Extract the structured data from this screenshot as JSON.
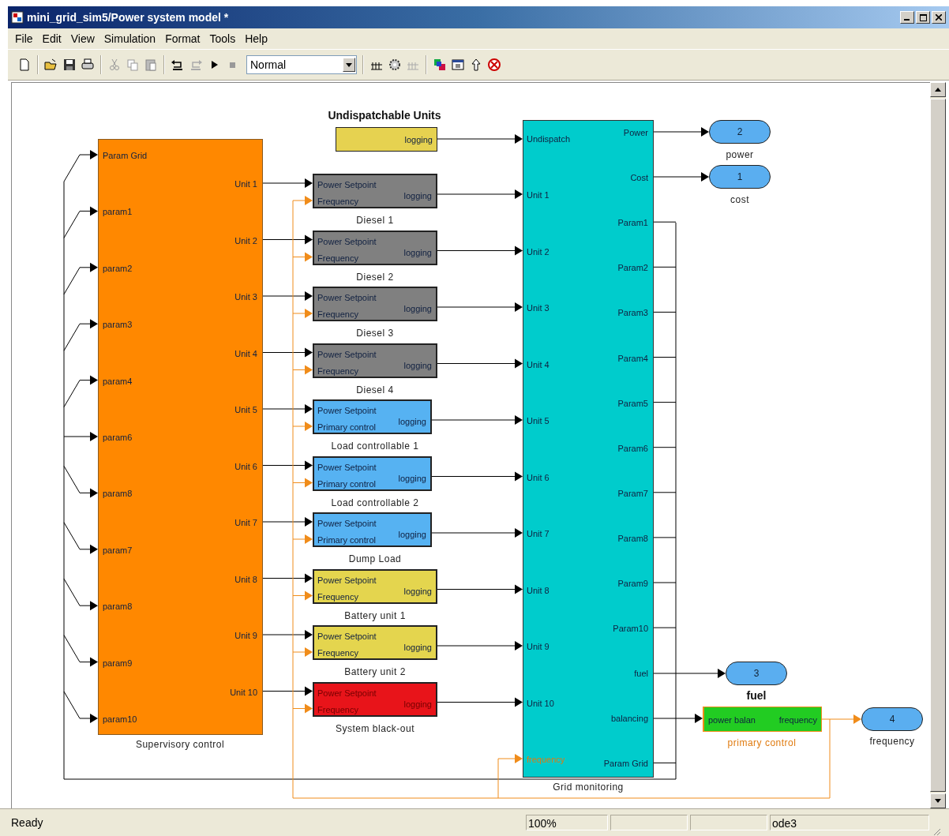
{
  "window": {
    "title": "mini_grid_sim5/Power system model *"
  },
  "menu": [
    "File",
    "Edit",
    "View",
    "Simulation",
    "Format",
    "Tools",
    "Help"
  ],
  "toolbar": {
    "mode": "Normal"
  },
  "diagram": {
    "supervisory": {
      "name": "Supervisory control",
      "inputs": [
        "Param Grid",
        "param1",
        "param2",
        "param3",
        "param4",
        "param6",
        "param8",
        "param7",
        "param8",
        "param9",
        "param10"
      ],
      "outputs": [
        "Unit 1",
        "Unit 2",
        "Unit 3",
        "Unit 4",
        "Unit 5",
        "Unit 6",
        "Unit 7",
        "Unit 8",
        "Unit 9",
        "Unit 10"
      ]
    },
    "undispatchable": {
      "title": "Undispatchable Units",
      "output": "logging"
    },
    "units": [
      {
        "name": "Diesel 1",
        "color": "#808080",
        "inputs": [
          "Power Setpoint",
          "Frequency"
        ],
        "output": "logging"
      },
      {
        "name": "Diesel 2",
        "color": "#808080",
        "inputs": [
          "Power Setpoint",
          "Frequency"
        ],
        "output": "logging"
      },
      {
        "name": "Diesel 3",
        "color": "#808080",
        "inputs": [
          "Power Setpoint",
          "Frequency"
        ],
        "output": "logging"
      },
      {
        "name": "Diesel 4",
        "color": "#808080",
        "inputs": [
          "Power Setpoint",
          "Frequency"
        ],
        "output": "logging"
      },
      {
        "name": "Load controllable 1",
        "color": "#56b2f2",
        "inputs": [
          "Power Setpoint",
          "Primary control"
        ],
        "output": "logging"
      },
      {
        "name": "Load controllable 2",
        "color": "#56b2f2",
        "inputs": [
          "Power Setpoint",
          "Primary control"
        ],
        "output": "logging"
      },
      {
        "name": "Dump Load",
        "color": "#56b2f2",
        "inputs": [
          "Power Setpoint",
          "Primary control"
        ],
        "output": "logging"
      },
      {
        "name": "Battery unit 1",
        "color": "#e4d54e",
        "inputs": [
          "Power Setpoint",
          "Frequency"
        ],
        "output": "logging"
      },
      {
        "name": "Battery unit 2",
        "color": "#e4d54e",
        "inputs": [
          "Power Setpoint",
          "Frequency"
        ],
        "output": "logging"
      },
      {
        "name": "System black-out",
        "color": "#e8141a",
        "inputs": [
          "Power Setpoint",
          "Frequency"
        ],
        "output": "logging"
      }
    ],
    "monitor": {
      "name": "Grid monitoring",
      "inputs": [
        "Undispatch",
        "Unit 1",
        "Unit 2",
        "Unit 3",
        "Unit 4",
        "Unit 5",
        "Unit 6",
        "Unit 7",
        "Unit 8",
        "Unit 9",
        "Unit 10",
        "frequency"
      ],
      "outputs": [
        "Power",
        "Cost",
        "Param1",
        "Param2",
        "Param3",
        "Param4",
        "Param5",
        "Param6",
        "Param7",
        "Param8",
        "Param9",
        "Param10",
        "fuel",
        "balancing",
        "Param Grid"
      ]
    },
    "outports": [
      {
        "number": "2",
        "name": "power"
      },
      {
        "number": "1",
        "name": "cost"
      },
      {
        "number": "3",
        "name": "fuel"
      },
      {
        "number": "4",
        "name": "frequency"
      }
    ],
    "primary": {
      "name": "primary control",
      "input": "power balan",
      "output": "frequency"
    }
  },
  "status_bar": [
    "Ready",
    "100%",
    "ode3"
  ]
}
